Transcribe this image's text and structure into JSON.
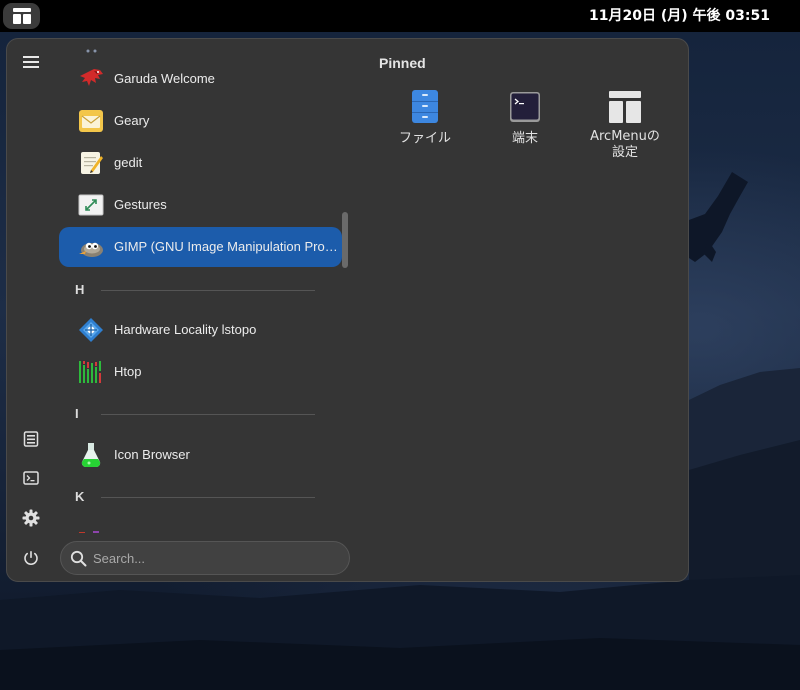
{
  "topbar": {
    "clock": "11月20日 (月) 午後 03:51",
    "activities_icon": "arcmenu-layout-icon"
  },
  "menu": {
    "rail": [
      {
        "name": "hamburger-menu-icon"
      },
      {
        "name": "documents-icon"
      },
      {
        "name": "terminal-icon"
      },
      {
        "name": "settings-gear-icon"
      },
      {
        "name": "power-icon"
      }
    ],
    "apps": [
      {
        "label": "Garuda Welcome",
        "icon": "garuda-eagle-icon"
      },
      {
        "label": "Geary",
        "icon": "geary-mail-icon"
      },
      {
        "label": "gedit",
        "icon": "gedit-notepad-icon"
      },
      {
        "label": "Gestures",
        "icon": "gestures-icon"
      },
      {
        "label": "GIMP (GNU Image Manipulation Program)",
        "icon": "gimp-icon",
        "selected": true
      },
      {
        "label": "Hardware Locality lstopo",
        "icon": "lstopo-icon"
      },
      {
        "label": "Htop",
        "icon": "htop-icon"
      },
      {
        "label": "Icon Browser",
        "icon": "icon-browser-flask-icon"
      }
    ],
    "sections": [
      "H",
      "I",
      "K"
    ],
    "search": {
      "placeholder": "Search..."
    },
    "pinned": {
      "title": "Pinned",
      "items": [
        {
          "label": "ファイル",
          "icon": "files-cabinet-icon"
        },
        {
          "label": "端末",
          "icon": "terminal-icon"
        },
        {
          "label": "ArcMenuの設定",
          "label_line1": "ArcMenuの",
          "label_line2": "設定",
          "icon": "arcmenu-settings-icon"
        }
      ]
    }
  }
}
